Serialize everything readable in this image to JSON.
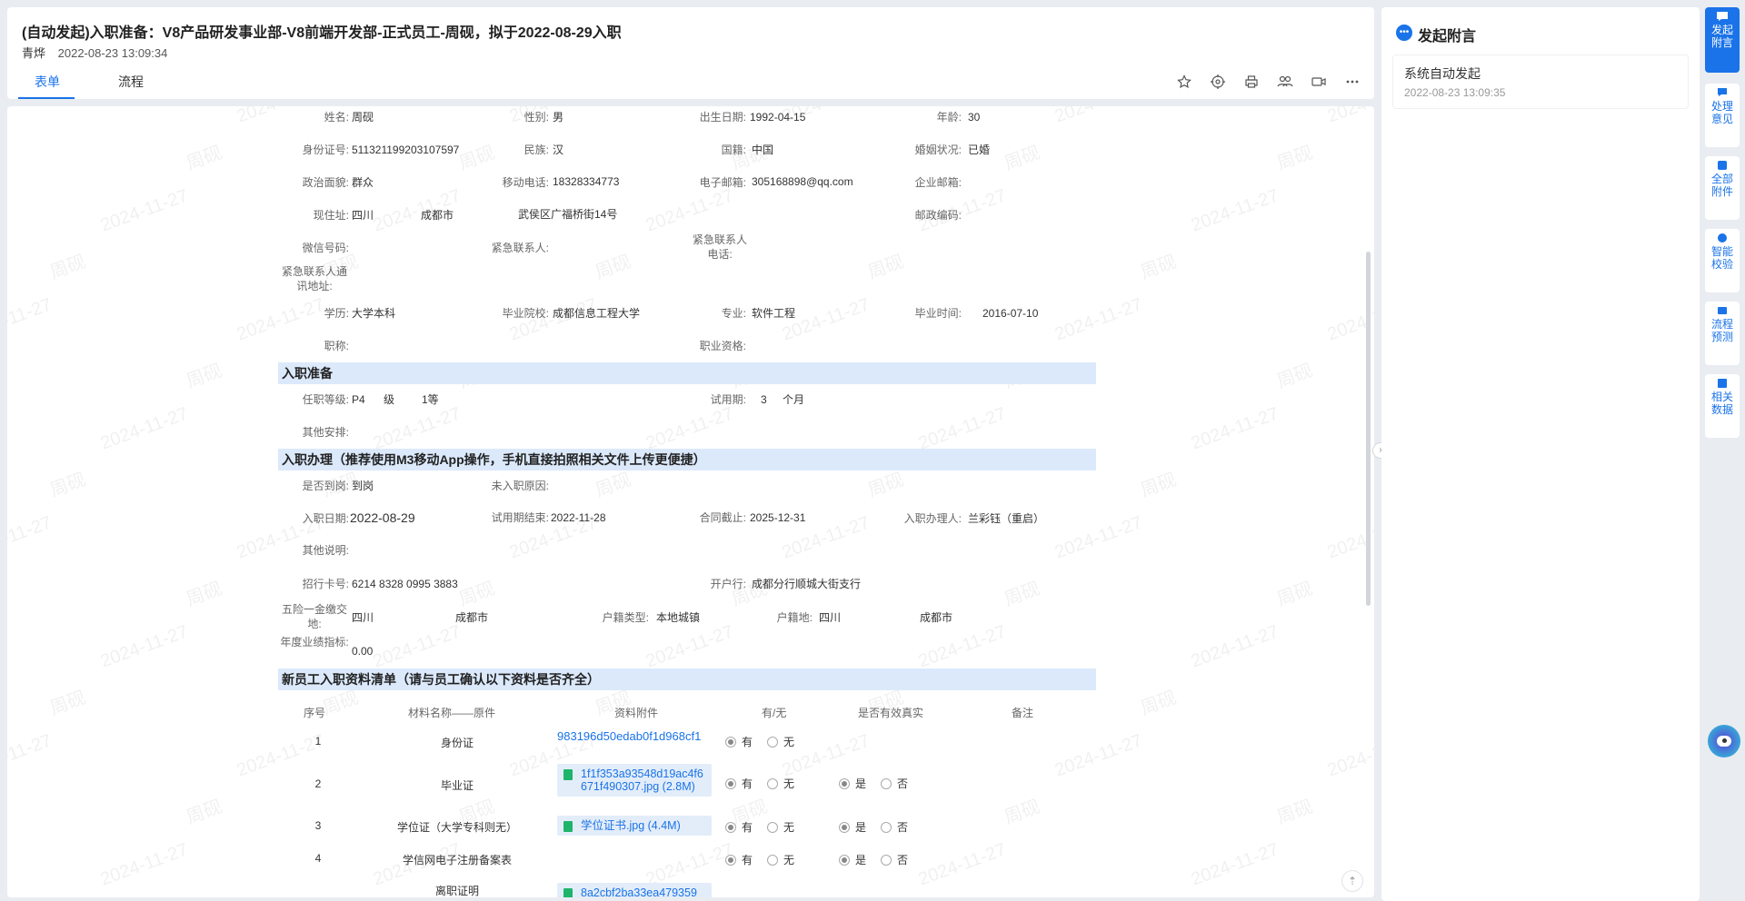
{
  "header": {
    "title": "(自动发起)入职准备：V8产品研发事业部-V8前端开发部-正式员工-周砚，拟于2022-08-29入职",
    "user": "青烨",
    "time": "2022-08-23 13:09:34",
    "tabs": [
      "表单",
      "流程"
    ],
    "tools": [
      "star-icon",
      "target-icon",
      "print-icon",
      "users-icon",
      "video-icon",
      "more-icon"
    ]
  },
  "watermark": {
    "name": "周砚",
    "date": "2024-11-27"
  },
  "basic": {
    "name_label": "姓名:",
    "name": "周砚",
    "gender_label": "性别:",
    "gender": "男",
    "birth_label": "出生日期:",
    "birth": "1992-04-15",
    "age_label": "年龄:",
    "age": "30",
    "idcard_label": "身份证号:",
    "idcard": "511321199203107597",
    "ethnic_label": "民族:",
    "ethnic": "汉",
    "nation_label": "国籍:",
    "nation": "中国",
    "marital_label": "婚姻状况:",
    "marital": "已婚",
    "political_label": "政治面貌:",
    "political": "群众",
    "mobile_label": "移动电话:",
    "mobile": "18328334773",
    "email_label": "电子邮箱:",
    "email": "305168898@qq.com",
    "corp_email_label": "企业邮箱:",
    "address_label": "现住址:",
    "addr_province": "四川",
    "addr_city": "成都市",
    "addr_detail": "武侯区广福桥街14号",
    "postcode_label": "邮政编码:",
    "wechat_label": "微信号码:",
    "emerg_contact_label": "紧急联系人:",
    "emerg_phone_label": "紧急联系人电话:",
    "emerg_addr_label": "紧急联系人通讯地址:",
    "edu_label": "学历:",
    "edu": "大学本科",
    "school_label": "毕业院校:",
    "school": "成都信息工程大学",
    "major_label": "专业:",
    "major": "软件工程",
    "grad_label": "毕业时间:",
    "grad": "2016-07-10",
    "title_label": "职称:",
    "qualification_label": "职业资格:"
  },
  "prep": {
    "section": "入职准备",
    "level_label": "任职等级:",
    "level": "P4",
    "level_unit": "级",
    "grade": "1等",
    "probation_label": "试用期:",
    "probation": "3",
    "probation_unit": "个月",
    "other_label": "其他安排:"
  },
  "onboard": {
    "section": "入职办理（推荐使用M3移动App操作，手机直接拍照相关文件上传更便捷）",
    "arrived_label": "是否到岗:",
    "arrived": "到岗",
    "reason_label": "未入职原因:",
    "date_label": "入职日期:",
    "date": "2022-08-29",
    "prob_end_label": "试用期结束:",
    "prob_end": "2022-11-28",
    "contract_label": "合同截止:",
    "contract": "2025-12-31",
    "handler_label": "入职办理人:",
    "handler": "兰彩钰（重启）",
    "note_label": "其他说明:",
    "card_label": "招行卡号:",
    "card": "6214 8328 0995 3883",
    "bank_label": "开户行:",
    "bank": "成都分行顺城大街支行",
    "insurance_label": "五险一金缴交地:",
    "ins_province": "四川",
    "ins_city": "成都市",
    "hukou_type_label": "户籍类型:",
    "hukou_type": "本地城镇",
    "hukou_label": "户籍地:",
    "hukou_province": "四川",
    "hukou_city": "成都市",
    "perf_label": "年度业绩指标:",
    "perf": "0.00"
  },
  "checklist": {
    "section": "新员工入职资料清单（请与员工确认以下资料是否齐全）",
    "headers": [
      "序号",
      "材料名称——原件",
      "资料附件",
      "有/无",
      "是否有效真实",
      "备注"
    ],
    "opt_yes": "有",
    "opt_no": "无",
    "valid_yes": "是",
    "valid_no": "否",
    "rows": [
      {
        "no": "1",
        "name": "身份证",
        "file": "983196d50edab0f1d968cf1"
      },
      {
        "no": "2",
        "name": "毕业证",
        "file": "1f1f353a93548d19ac4f6671f490307.jpg (2.8M)",
        "file_l1": "1f1f353a93548d19ac4f6",
        "file_l2": "671f490307.jpg (2.8M)"
      },
      {
        "no": "3",
        "name": "学位证（大学专科则无）",
        "file": "学位证书.jpg (4.4M)"
      },
      {
        "no": "4",
        "name": "学信网电子注册备案表"
      },
      {
        "no": "",
        "name": "离职证明",
        "file": "8a2cbf2ba33ea479359"
      }
    ]
  },
  "right_panel": {
    "title": "发起附言",
    "item_text": "系统自动发起",
    "item_time": "2022-08-23 13:09:35"
  },
  "sidebar": [
    {
      "l1": "发起",
      "l2": "附言",
      "icon": "chat-icon"
    },
    {
      "l1": "处理",
      "l2": "意见",
      "icon": "comment-icon"
    },
    {
      "l1": "全部",
      "l2": "附件",
      "icon": "attachment-icon"
    },
    {
      "l1": "智能",
      "l2": "校验",
      "icon": "check-icon"
    },
    {
      "l1": "流程",
      "l2": "预测",
      "icon": "flow-icon"
    },
    {
      "l1": "相关",
      "l2": "数据",
      "icon": "data-icon"
    }
  ],
  "colors": {
    "accent": "#1a73e8",
    "section_bg": "#dbe9fb",
    "file_bg": "#e3edf9"
  }
}
